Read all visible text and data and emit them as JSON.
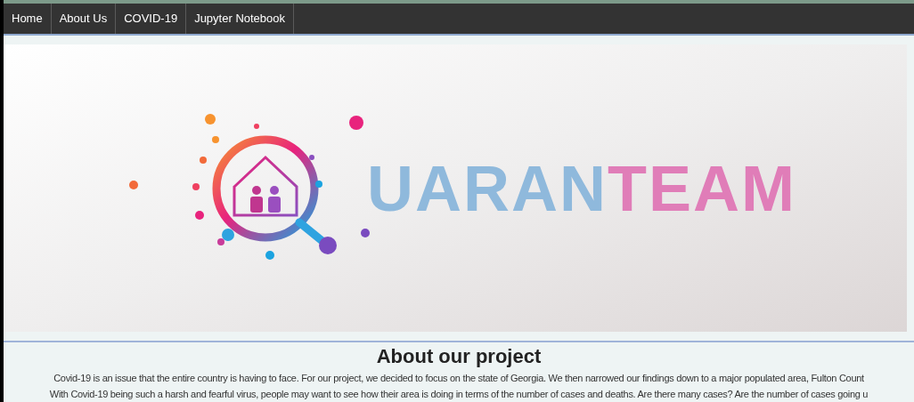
{
  "nav": {
    "items": [
      {
        "label": "Home"
      },
      {
        "label": "About Us"
      },
      {
        "label": "COVID-19"
      },
      {
        "label": "Jupyter Notebook"
      }
    ]
  },
  "banner": {
    "wordmark": [
      "UARAN",
      "TEAM"
    ]
  },
  "about": {
    "heading": "About our project",
    "lines": [
      "Covid-19 is an issue that the entire country is having to face. For our project, we decided to focus on the state of Georgia. We then narrowed our findings down to a major populated area, Fulton Count",
      "With Covid-19 being such a harsh and fearful virus, people may want to see how their area is doing in terms of the number of cases and deaths. Are there many cases? Are the number of cases going u"
    ]
  }
}
